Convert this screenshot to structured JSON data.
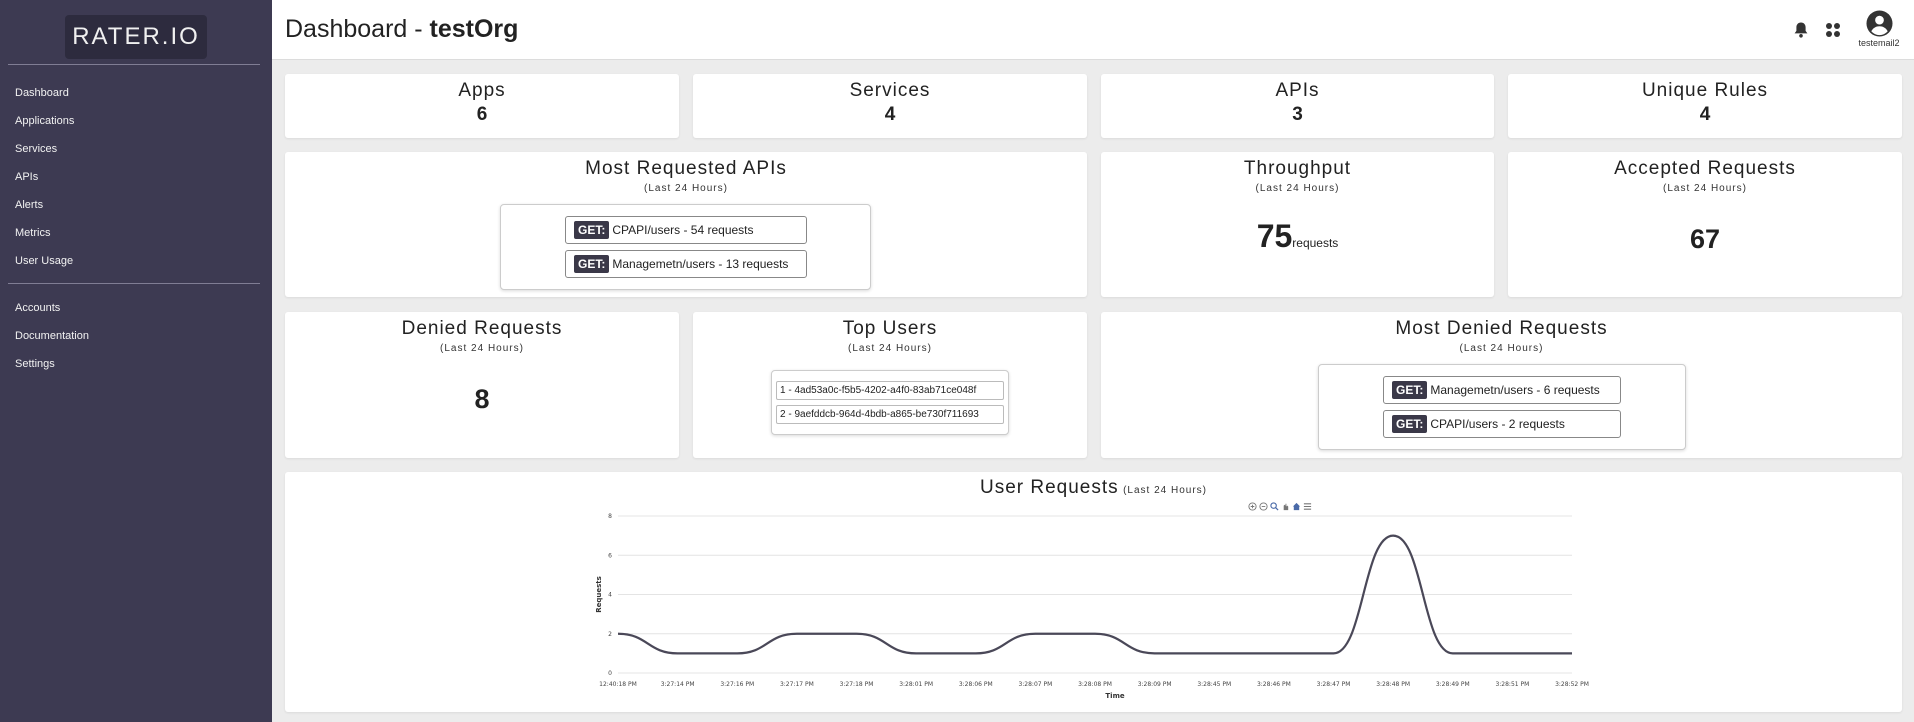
{
  "sidebar": {
    "logo": "RATER.IO",
    "nav": [
      "Dashboard",
      "Applications",
      "Services",
      "APIs",
      "Alerts",
      "Metrics",
      "User Usage"
    ],
    "nav2": [
      "Accounts",
      "Documentation",
      "Settings"
    ]
  },
  "header": {
    "title_prefix": "Dashboard - ",
    "org": "testOrg",
    "username": "testemail2"
  },
  "stats": {
    "apps": {
      "label": "Apps",
      "value": "6"
    },
    "services": {
      "label": "Services",
      "value": "4"
    },
    "apis": {
      "label": "APIs",
      "value": "3"
    },
    "unique_rules": {
      "label": "Unique Rules",
      "value": "4"
    }
  },
  "period": "(Last 24 Hours)",
  "most_requested": {
    "title": "Most Requested APIs",
    "items": [
      {
        "method": "GET:",
        "text": "CPAPI/users - 54 requests"
      },
      {
        "method": "GET:",
        "text": "Managemetn/users - 13 requests"
      }
    ]
  },
  "throughput": {
    "title": "Throughput",
    "value": "75",
    "unit": "requests"
  },
  "accepted": {
    "title": "Accepted Requests",
    "value": "67"
  },
  "denied": {
    "title": "Denied Requests",
    "value": "8"
  },
  "top_users": {
    "title": "Top Users",
    "items": [
      "1 - 4ad53a0c-f5b5-4202-a4f0-83ab71ce048f",
      "2 - 9aefddcb-964d-4bdb-a865-be730f711693"
    ]
  },
  "most_denied": {
    "title": "Most Denied Requests",
    "items": [
      {
        "method": "GET:",
        "text": "Managemetn/users - 6 requests"
      },
      {
        "method": "GET:",
        "text": "CPAPI/users - 2 requests"
      }
    ]
  },
  "user_requests": {
    "title": "User Requests",
    "sub": "(Last 24 Hours)"
  },
  "chart_data": {
    "type": "line",
    "x": [
      "12:40:18 PM",
      "3:27:14 PM",
      "3:27:16 PM",
      "3:27:17 PM",
      "3:27:18 PM",
      "3:28:01 PM",
      "3:28:06 PM",
      "3:28:07 PM",
      "3:28:08 PM",
      "3:28:09 PM",
      "3:28:45 PM",
      "3:28:46 PM",
      "3:28:47 PM",
      "3:28:48 PM",
      "3:28:49 PM",
      "3:28:51 PM",
      "3:28:52 PM"
    ],
    "series": [
      {
        "values": [
          2,
          1,
          1,
          2,
          2,
          1,
          1,
          2,
          2,
          1,
          1,
          1,
          1,
          7,
          1,
          1,
          1
        ]
      }
    ],
    "xlabel": "Time",
    "ylabel": "Requests",
    "yticks": [
      "0",
      "2",
      "4",
      "6",
      "8"
    ],
    "ylim": [
      0,
      8
    ],
    "grid": true,
    "line_color": "#4a4858"
  }
}
